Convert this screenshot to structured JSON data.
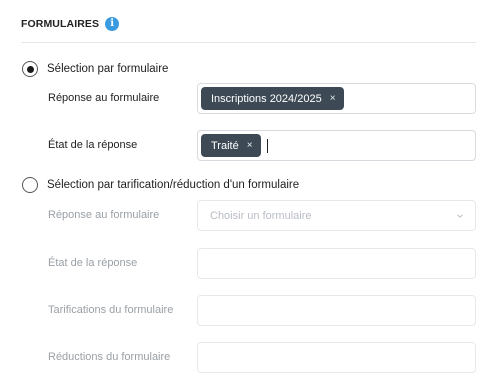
{
  "section": {
    "title": "FORMULAIRES",
    "info_icon": "info-icon"
  },
  "option_form": {
    "label": "Sélection par formulaire",
    "selected": true,
    "response_label": "Réponse au formulaire",
    "response_chip": "Inscriptions 2024/2025",
    "state_label": "État de la réponse",
    "state_chip": "Traité",
    "remove_symbol": "×"
  },
  "option_pricing": {
    "label": "Sélection par tarification/réduction d'un formulaire",
    "selected": false,
    "response_label": "Réponse au formulaire",
    "response_placeholder": "Choisir un formulaire",
    "state_label": "État de la réponse",
    "pricing_label": "Tarifications du formulaire",
    "reductions_label": "Réductions du formulaire"
  },
  "colors": {
    "accent": "#3b9be0",
    "chip": "#3d4a55"
  }
}
